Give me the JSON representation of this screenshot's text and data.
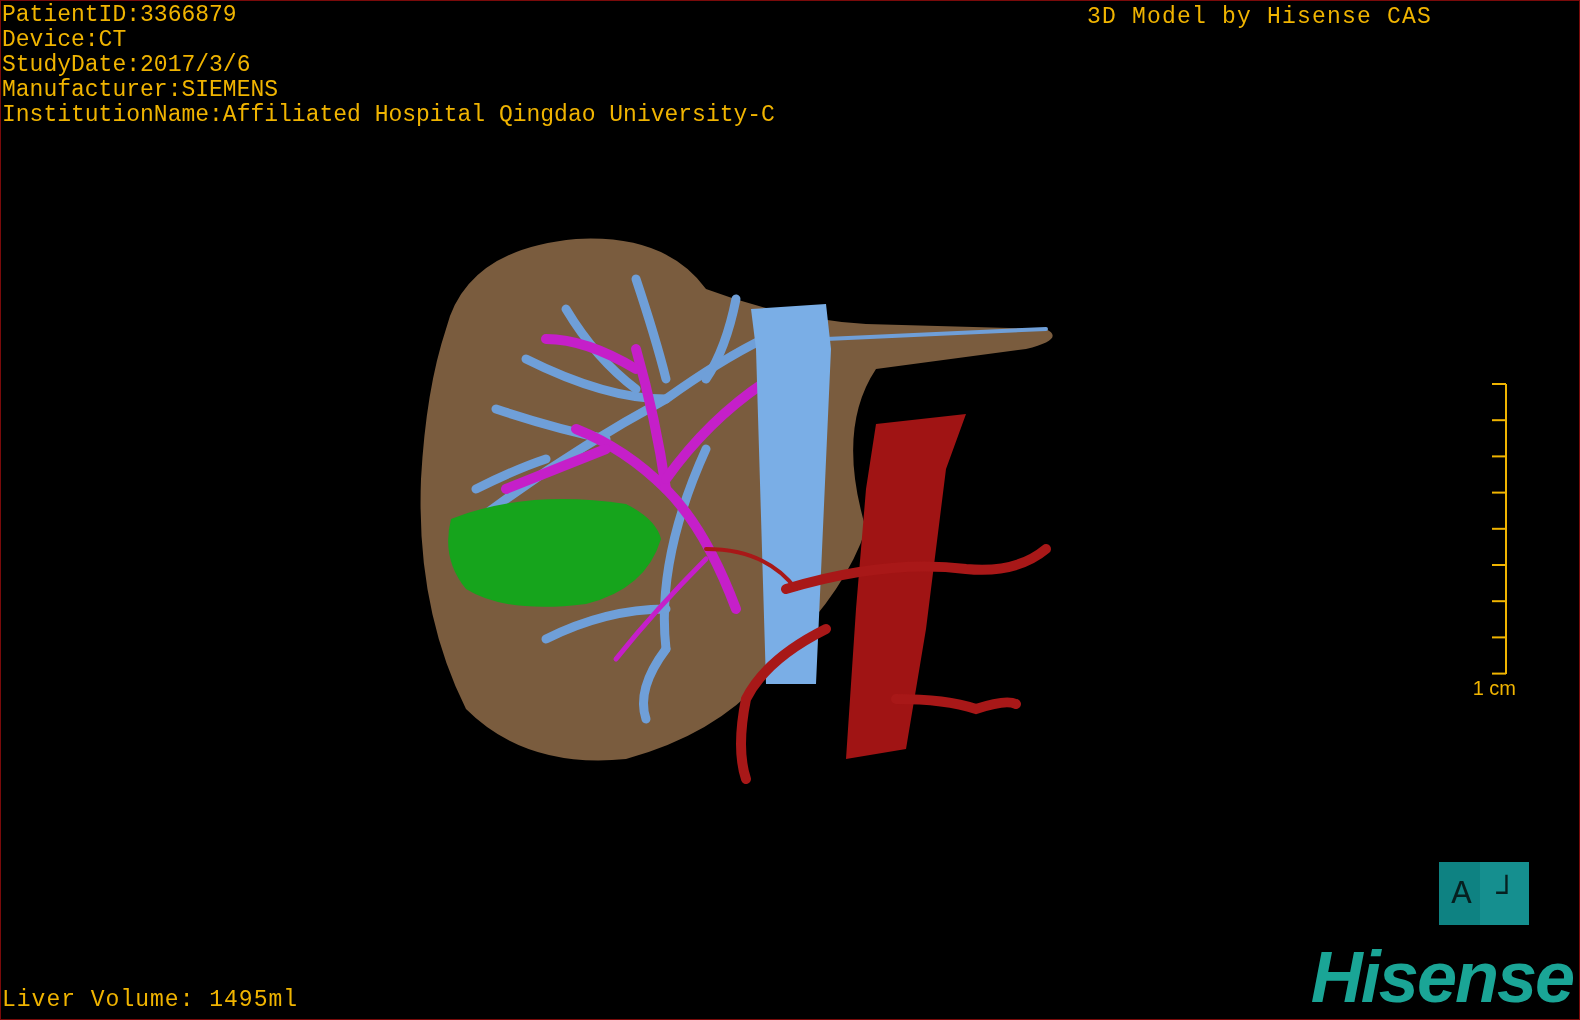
{
  "patient_info": [
    "PatientID:3366879",
    "Device:CT",
    "StudyDate:2017/3/6",
    "Manufacturer:SIEMENS",
    "InstitutionName:Affiliated Hospital Qingdao University-C"
  ],
  "model_credit": "3D Model by Hisense CAS",
  "scale_bar": {
    "label": "1 cm"
  },
  "orientation": {
    "label": "A",
    "mark": "┘"
  },
  "logo": "Hisense",
  "liver_volume": "Liver Volume: 1495ml"
}
